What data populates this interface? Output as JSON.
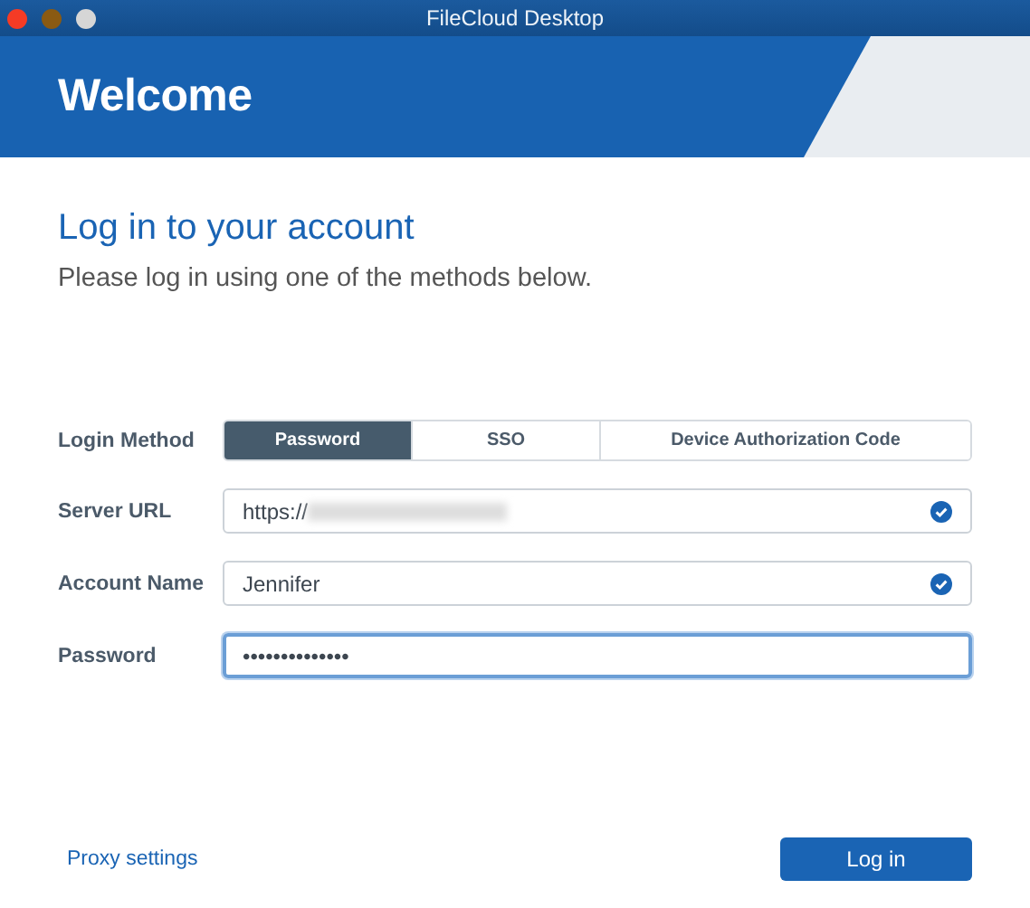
{
  "window": {
    "title": "FileCloud Desktop"
  },
  "header": {
    "title": "Welcome"
  },
  "heading": "Log in to your account",
  "subtitle": "Please log in using one of the methods below.",
  "login_method": {
    "label": "Login Method",
    "options": [
      {
        "label": "Password",
        "selected": true
      },
      {
        "label": "SSO",
        "selected": false
      },
      {
        "label": "Device Authorization Code",
        "selected": false
      }
    ]
  },
  "fields": [
    {
      "label": "Server URL",
      "value": "https://",
      "blurred": true,
      "valid": true,
      "focused": false
    },
    {
      "label": "Account Name",
      "value": "Jennifer",
      "blurred": false,
      "valid": true,
      "focused": false
    },
    {
      "label": "Password",
      "value": "••••••••••••••",
      "blurred": false,
      "valid": false,
      "focused": true
    }
  ],
  "footer": {
    "link": "Proxy settings",
    "button": "Log in"
  }
}
